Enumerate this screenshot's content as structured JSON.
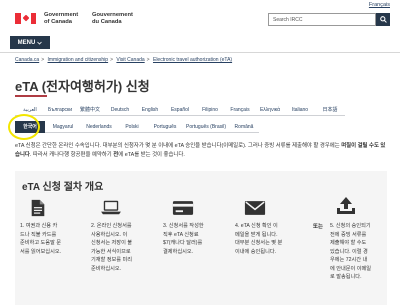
{
  "top": {
    "language_link": "Français"
  },
  "header": {
    "gov_en_line1": "Government",
    "gov_en_line2": "of Canada",
    "gov_fr_line1": "Gouvernement",
    "gov_fr_line2": "du Canada",
    "search_placeholder": "Search IRCC",
    "menu_label": "MENU"
  },
  "breadcrumb": [
    "Canada.ca",
    "Immigration and citizenship",
    "Visit Canada",
    "Electronic travel authorization (eTA)"
  ],
  "page_title": "eTA (전자여행허가) 신청",
  "languages": {
    "row1": [
      "العربية",
      "Български",
      "繁體中文",
      "Deutsch",
      "English",
      "Español",
      "Filipino",
      "Français",
      "Ελληνικά",
      "Italiano",
      "日本語"
    ],
    "row2": [
      "한국어",
      "Magyarul",
      "Nederlands",
      "Polski",
      "Português",
      "Português (Brasil)",
      "Română"
    ],
    "active": "한국어"
  },
  "intro": {
    "part1": "eTA 신청은 간단한 온라인 수속입니다. 대부분의 신청자가 몇 분 이내에 eTA 승인을 받습니다(이메일로). 그러나 증빙 서류를 제출해야 할",
    "part2": "경우에는 ",
    "bold": "며칠이 걸릴 수도 있습니다",
    "part3": ". 따라서 캐나다행 항공편을 예약하기 ",
    "bold2": "전",
    "part4": "에 eTA를 받는 것이 좋습니다."
  },
  "steps_panel": {
    "title": "eTA 신청 절차 개요",
    "or_label": "또는",
    "steps": [
      {
        "icon": "document-icon",
        "lines": [
          "1. 여권과 신용 카",
          "드나 직불 카드를",
          "준비하고 도움말 문",
          "서를 읽어보십시오."
        ]
      },
      {
        "icon": "laptop-icon",
        "lines": [
          "2. 온라인 신청서를",
          "사용하십시오. 이",
          "신청서는 저장이 불",
          "가능한 서식이므로",
          "기재할 정보를 미리",
          "준비하십시오."
        ]
      },
      {
        "icon": "credit-card-icon",
        "lines": [
          "3. 신청서를 작성한",
          "직후 eTA 신청료",
          "$7(캐나다 달러)를",
          "결제하십시오."
        ]
      },
      {
        "icon": "email-icon",
        "lines": [
          "4. eTA 신청 확인 이",
          "메일을 받게 됩니다.",
          "대부분 신청서는 몇 분",
          "이내에 승인됩니다."
        ]
      },
      {
        "icon": "upload-icon",
        "lines": [
          "5. 신청의 승인되기",
          "전에 증빙 서류를",
          "제출해야 할 수도",
          "있습니다. 이럴 경",
          "우에는 72시간 내",
          "에 안내문이 이메일",
          "로 발송됩니다."
        ]
      }
    ]
  },
  "colors": {
    "brand_dark": "#26374a",
    "flag_red": "#eb2d37",
    "accent_rule": "#af3c43",
    "highlight": "#f3e600"
  }
}
